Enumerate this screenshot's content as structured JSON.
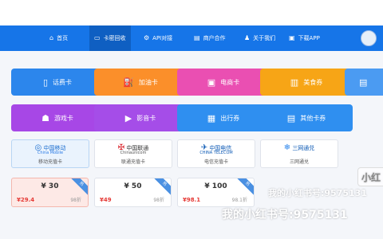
{
  "nav": {
    "items": [
      {
        "label": "首页",
        "icon": "home-icon",
        "glyph": "⌂"
      },
      {
        "label": "卡密回收",
        "icon": "card-icon",
        "glyph": "▭"
      },
      {
        "label": "API对接",
        "icon": "api-icon",
        "glyph": "⚙"
      },
      {
        "label": "商户合作",
        "icon": "shop-icon",
        "glyph": "▤"
      },
      {
        "label": "关于我们",
        "icon": "people-icon",
        "glyph": "♟"
      },
      {
        "label": "下载APP",
        "icon": "download-icon",
        "glyph": "▣"
      }
    ],
    "active_index": 1,
    "colors": {
      "bar": "#1675e8",
      "active": "#0f5fc2"
    }
  },
  "categories": [
    {
      "label": "话费卡",
      "icon": "phone-icon",
      "glyph": "▯",
      "color": "#2c86ec"
    },
    {
      "label": "加油卡",
      "icon": "fuel-icon",
      "glyph": "⛽",
      "color": "#fb8f2a"
    },
    {
      "label": "电商卡",
      "icon": "shopping-icon",
      "glyph": "▣",
      "color": "#ea4fb2"
    },
    {
      "label": "美食券",
      "icon": "food-icon",
      "glyph": "▥",
      "color": "#f7a516"
    },
    {
      "label": "",
      "icon": "shop-icon",
      "glyph": "▤",
      "color": "#4b9bf2"
    },
    {
      "label": "游戏卡",
      "icon": "gamepad-icon",
      "glyph": "☗",
      "color": "#a747e6"
    },
    {
      "label": "影音卡",
      "icon": "video-icon",
      "glyph": "▶",
      "color": "#a54de8"
    },
    {
      "label": "出行券",
      "icon": "bus-icon",
      "glyph": "▦",
      "color": "#2f8ff0"
    },
    {
      "label": "其他卡券",
      "icon": "ticket-icon",
      "glyph": "▤",
      "color": "#2f8ff0"
    }
  ],
  "operators": [
    {
      "name": "中国移动",
      "sub": "China Mobile",
      "label": "移动充值卡",
      "icon": "china-mobile-logo-icon",
      "glyph": "◎"
    },
    {
      "name": "中国联通",
      "sub": "Chinaunicom",
      "label": "联通充值卡",
      "icon": "china-unicom-logo-icon",
      "glyph": "✠"
    },
    {
      "name": "中国电信",
      "sub": "CHINA TELECOM",
      "label": "电信充值卡",
      "icon": "china-telecom-logo-icon",
      "glyph": "✈"
    },
    {
      "name": "三网通兑",
      "sub": "",
      "label": "三网通兑",
      "icon": "three-network-logo-icon",
      "glyph": "❄"
    }
  ],
  "prices": [
    {
      "face": "¥ 30",
      "sale": "¥29.4",
      "discount": "98折",
      "badge": "热"
    },
    {
      "face": "¥ 50",
      "sale": "¥49",
      "discount": "98折",
      "badge": "热"
    },
    {
      "face": "¥ 100",
      "sale": "¥98.1",
      "discount": "98.1折",
      "badge": "热"
    }
  ],
  "watermark": {
    "small": "我的小红书号:9575131",
    "large": "我的小红书号:9575131",
    "side": "小红"
  }
}
